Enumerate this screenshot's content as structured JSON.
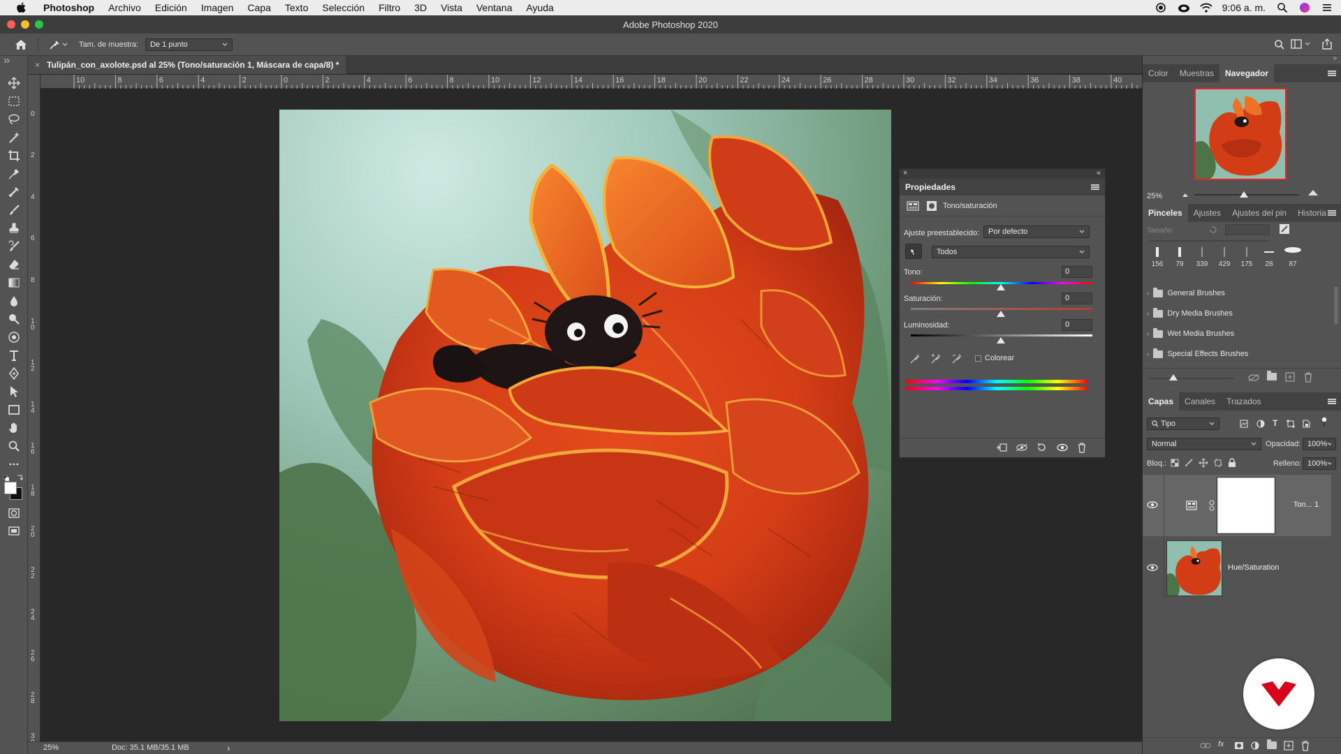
{
  "menubar": {
    "app": "Photoshop",
    "items": [
      "Archivo",
      "Edición",
      "Imagen",
      "Capa",
      "Texto",
      "Selección",
      "Filtro",
      "3D",
      "Vista",
      "Ventana",
      "Ayuda"
    ],
    "clock": "9:06 a. m."
  },
  "window": {
    "title": "Adobe Photoshop 2020"
  },
  "options": {
    "sample_label": "Tam. de muestra:",
    "sample_value": "De 1 punto"
  },
  "document": {
    "tab_title": "Tulipán_con_axolote.psd al 25% (Tono/saturación 1, Máscara de capa/8) *",
    "ruler_top": [
      "10",
      "8",
      "6",
      "4",
      "2",
      "0",
      "2",
      "4",
      "6",
      "8",
      "10",
      "12",
      "14",
      "16",
      "18",
      "20",
      "22",
      "24",
      "26",
      "28",
      "30",
      "32",
      "34",
      "36",
      "38",
      "40"
    ],
    "ruler_left": [
      "0",
      "2",
      "4",
      "6",
      "8",
      "10",
      "12",
      "14",
      "16",
      "18",
      "20",
      "22",
      "24",
      "26",
      "28",
      "30"
    ]
  },
  "status": {
    "zoom": "25%",
    "doc": "Doc: 35.1 MB/35.1 MB",
    "arrow": "›"
  },
  "properties": {
    "title": "Propiedades",
    "adjustment": "Tono/saturación",
    "preset_label": "Ajuste preestablecido:",
    "preset_value": "Por defecto",
    "channel_value": "Todos",
    "hue": {
      "label": "Tono:",
      "value": "0"
    },
    "saturation": {
      "label": "Saturación:",
      "value": "0"
    },
    "lightness": {
      "label": "Luminosidad:",
      "value": "0"
    },
    "colorize_label": "Colorear"
  },
  "navigator": {
    "tabs": [
      "Color",
      "Muestras",
      "Navegador"
    ],
    "active_tab": "Navegador",
    "zoom": "25%"
  },
  "brushes": {
    "tabs": [
      "Pinceles",
      "Ajustes",
      "Ajustes del pin",
      "Historia"
    ],
    "size_label": "Tamaño:",
    "presets": [
      "156",
      "79",
      "339",
      "429",
      "175",
      "28",
      "87"
    ],
    "groups": [
      "General Brushes",
      "Dry Media Brushes",
      "Wet Media Brushes",
      "Special Effects Brushes"
    ]
  },
  "layers": {
    "tabs": [
      "Capas",
      "Canales",
      "Trazados"
    ],
    "filter_value": "Tipo",
    "blend_mode": "Normal",
    "opacity_label": "Opacidad:",
    "opacity_value": "100%",
    "lock_label": "Bloq.:",
    "fill_label": "Relleno:",
    "fill_value": "100%",
    "items": [
      {
        "name": "Ton... 1"
      },
      {
        "name": "Hue/Saturation"
      }
    ]
  },
  "colors": {
    "accent_red": "#d9001b",
    "panel_bg": "#535353",
    "panel_dark": "#424242"
  }
}
